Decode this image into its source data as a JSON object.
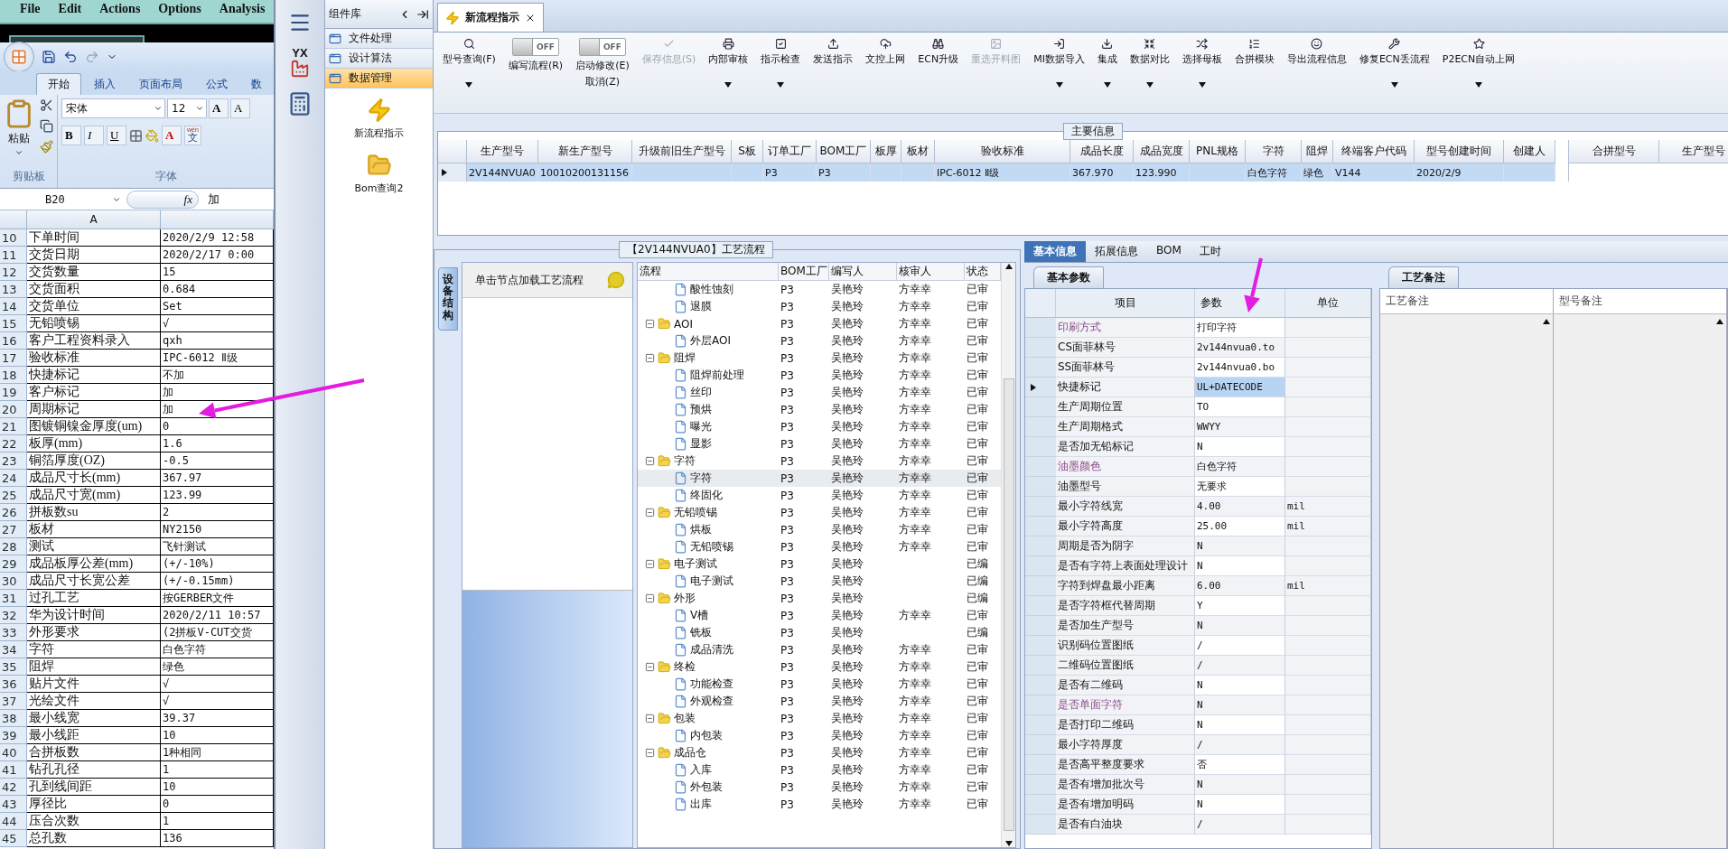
{
  "background_app": {
    "menu": [
      "File",
      "Edit",
      "Actions",
      "Options",
      "Analysis"
    ]
  },
  "excel": {
    "ribbon_tabs": [
      {
        "label": "开始",
        "selected": true
      },
      {
        "label": "插入",
        "selected": false
      },
      {
        "label": "页面布局",
        "selected": false
      },
      {
        "label": "公式",
        "selected": false
      },
      {
        "label": "数",
        "selected": false
      }
    ],
    "clipboard_group": {
      "paste": "粘贴",
      "title": "剪贴板"
    },
    "font_group": {
      "font": "宋体",
      "size": "12",
      "grow": "A",
      "shrink": "A",
      "bold": "B",
      "italic": "I",
      "underline": "U",
      "font_color": "A",
      "phonetic_top": "wén",
      "phonetic": "文",
      "title": "字体"
    },
    "name_box": "B20",
    "fx": "fx",
    "formula": "加",
    "column_header": "A",
    "rows": [
      {
        "num": "10",
        "label": "下单时间",
        "value": "2020/2/9 12:58"
      },
      {
        "num": "11",
        "label": "交货日期",
        "value": "2020/2/17 0:00"
      },
      {
        "num": "12",
        "label": "交货数量",
        "value": "15"
      },
      {
        "num": "13",
        "label": "交货面积",
        "value": "0.684"
      },
      {
        "num": "14",
        "label": "交货单位",
        "value": "Set"
      },
      {
        "num": "15",
        "label": "无铅喷锡",
        "value": "√"
      },
      {
        "num": "16",
        "label": "客户工程资料录入",
        "value": "qxh"
      },
      {
        "num": "17",
        "label": "验收标准",
        "value": "IPC-6012 Ⅱ级"
      },
      {
        "num": "18",
        "label": "快捷标记",
        "value": "不加"
      },
      {
        "num": "19",
        "label": "客户标记",
        "value": "加"
      },
      {
        "num": "20",
        "label": "周期标记",
        "value": "加"
      },
      {
        "num": "21",
        "label": "图镀铜镍金厚度(um)",
        "value": "0"
      },
      {
        "num": "22",
        "label": "板厚(mm)",
        "value": "1.6"
      },
      {
        "num": "23",
        "label": "铜箔厚度(OZ)",
        "value": "-0.5"
      },
      {
        "num": "24",
        "label": "成品尺寸长(mm)",
        "value": "367.97"
      },
      {
        "num": "25",
        "label": "成品尺寸宽(mm)",
        "value": "123.99"
      },
      {
        "num": "26",
        "label": "拼板数su",
        "value": "2"
      },
      {
        "num": "27",
        "label": "板材",
        "value": "NY2150"
      },
      {
        "num": "28",
        "label": "测试",
        "value": "飞针测试"
      },
      {
        "num": "29",
        "label": "成品板厚公差(mm)",
        "value": "(+/-10%)"
      },
      {
        "num": "30",
        "label": "成品尺寸长宽公差",
        "value": "(+/-0.15mm)"
      },
      {
        "num": "31",
        "label": "过孔工艺",
        "value": "按GERBER文件"
      },
      {
        "num": "32",
        "label": "华为设计时间",
        "value": "2020/2/11 10:57"
      },
      {
        "num": "33",
        "label": "外形要求",
        "value": "(2拼板V-CUT交货"
      },
      {
        "num": "34",
        "label": "字符",
        "value": "白色字符"
      },
      {
        "num": "35",
        "label": "阻焊",
        "value": "绿色"
      },
      {
        "num": "36",
        "label": "贴片文件",
        "value": "√"
      },
      {
        "num": "37",
        "label": "光绘文件",
        "value": "√"
      },
      {
        "num": "38",
        "label": "最小线宽",
        "value": "39.37"
      },
      {
        "num": "39",
        "label": "最小线距",
        "value": "10"
      },
      {
        "num": "40",
        "label": "合拼板数",
        "value": "1种相同"
      },
      {
        "num": "41",
        "label": "钻孔孔径",
        "value": "1"
      },
      {
        "num": "42",
        "label": "孔到线间距",
        "value": "10"
      },
      {
        "num": "43",
        "label": "厚径比",
        "value": "0"
      },
      {
        "num": "44",
        "label": "压合次数",
        "value": "1"
      },
      {
        "num": "45",
        "label": "总孔数",
        "value": "136"
      }
    ]
  },
  "nav": {
    "logo": "YX"
  },
  "component_library": {
    "title": "组件库",
    "items": [
      {
        "label": "文件处理",
        "selected": false
      },
      {
        "label": "设计算法",
        "selected": false
      },
      {
        "label": "数据管理",
        "selected": true
      }
    ],
    "tools": [
      {
        "label": "新流程指示",
        "kind": "bolt"
      },
      {
        "label": "Bom查询2",
        "kind": "folder"
      }
    ]
  },
  "doc_tab": {
    "label": "新流程指示"
  },
  "toolbar": [
    {
      "kind": "button",
      "label": [
        "型号查询(F)"
      ],
      "dropdown": true,
      "disabled": false
    },
    {
      "kind": "toggle",
      "label": [
        "编写流程(R)"
      ],
      "on": false,
      "state_text": "OFF"
    },
    {
      "kind": "toggle",
      "label": [
        "启动修改(E)",
        "取消(Z)"
      ],
      "on": false,
      "state_text": "OFF"
    },
    {
      "kind": "button",
      "label": [
        "保存信息(S)"
      ],
      "dropdown": false,
      "disabled": true
    },
    {
      "kind": "button",
      "label": [
        "内部审核"
      ],
      "dropdown": true,
      "disabled": false
    },
    {
      "kind": "button",
      "label": [
        "指示检查"
      ],
      "dropdown": true,
      "disabled": false
    },
    {
      "kind": "button",
      "label": [
        "发送指示"
      ],
      "dropdown": false,
      "disabled": false
    },
    {
      "kind": "button",
      "label": [
        "文控上网"
      ],
      "dropdown": false,
      "disabled": false
    },
    {
      "kind": "button",
      "label": [
        "ECN升级"
      ],
      "dropdown": false,
      "disabled": false
    },
    {
      "kind": "button",
      "label": [
        "重选开料图"
      ],
      "dropdown": false,
      "disabled": true
    },
    {
      "kind": "button",
      "label": [
        "MI数据导入"
      ],
      "dropdown": true,
      "disabled": false
    },
    {
      "kind": "button",
      "label": [
        "集成"
      ],
      "dropdown": true,
      "disabled": false
    },
    {
      "kind": "button",
      "label": [
        "数据对比"
      ],
      "dropdown": true,
      "disabled": false
    },
    {
      "kind": "button",
      "label": [
        "选择母板"
      ],
      "dropdown": true,
      "disabled": false
    },
    {
      "kind": "button",
      "label": [
        "合拼模块"
      ],
      "dropdown": false,
      "disabled": false
    },
    {
      "kind": "button",
      "label": [
        "导出流程信息"
      ],
      "dropdown": false,
      "disabled": false
    },
    {
      "kind": "button",
      "label": [
        "修复ECN丢流程"
      ],
      "dropdown": true,
      "disabled": false
    },
    {
      "kind": "button",
      "label": [
        "P2ECN自动上网"
      ],
      "dropdown": true,
      "disabled": false
    }
  ],
  "main_info": {
    "title": "主要信息",
    "columns": [
      "生产型号",
      "新生产型号",
      "升级前旧生产型号",
      "S板",
      "订单工厂",
      "BOM工厂",
      "板厚",
      "板材",
      "验收标准",
      "成品长度",
      "成品宽度",
      "PNL规格",
      "字符",
      "阻焊",
      "终端客户代码",
      "型号创建时间",
      "创建人"
    ],
    "rows": [
      {
        "selected": true,
        "cells": [
          "2V144NVUA0",
          "10010200131156",
          null,
          null,
          "P3",
          "P3",
          null,
          null,
          "IPC-6012 Ⅱ级",
          "367.970",
          "123.990",
          null,
          "白色字符",
          "绿色",
          "V144",
          "2020/2/9",
          null
        ]
      }
    ],
    "merge_columns": [
      "合拼型号",
      "生产型号"
    ]
  },
  "flow": {
    "title": "【2V144NVUA0】工艺流程",
    "side_tab": "设备结构",
    "hint": "单击节点加载工艺流程",
    "columns": [
      "流程",
      "BOM工厂",
      "编写人",
      "核审人",
      "状态"
    ],
    "partial_group_children": [
      {
        "label": "酸性蚀刻",
        "bom": "P3",
        "writer": "吴艳玲",
        "reviewer": "方幸幸",
        "status": "已审",
        "selected": false
      },
      {
        "label": "退膜",
        "bom": "P3",
        "writer": "吴艳玲",
        "reviewer": "方幸幸",
        "status": "已审",
        "selected": false
      }
    ],
    "groups": [
      {
        "label": "AOI",
        "bom": "P3",
        "writer": "吴艳玲",
        "reviewer": "方幸幸",
        "status": "已审",
        "selected": false,
        "expanded": true,
        "children": [
          {
            "label": "外层AOI",
            "bom": "P3",
            "writer": "吴艳玲",
            "reviewer": "方幸幸",
            "status": "已审",
            "selected": false
          }
        ]
      },
      {
        "label": "阻焊",
        "bom": "P3",
        "writer": "吴艳玲",
        "reviewer": "方幸幸",
        "status": "已审",
        "selected": false,
        "expanded": true,
        "children": [
          {
            "label": "阻焊前处理",
            "bom": "P3",
            "writer": "吴艳玲",
            "reviewer": "方幸幸",
            "status": "已审",
            "selected": false
          },
          {
            "label": "丝印",
            "bom": "P3",
            "writer": "吴艳玲",
            "reviewer": "方幸幸",
            "status": "已审",
            "selected": false
          },
          {
            "label": "预烘",
            "bom": "P3",
            "writer": "吴艳玲",
            "reviewer": "方幸幸",
            "status": "已审",
            "selected": false
          },
          {
            "label": "曝光",
            "bom": "P3",
            "writer": "吴艳玲",
            "reviewer": "方幸幸",
            "status": "已审",
            "selected": false
          },
          {
            "label": "显影",
            "bom": "P3",
            "writer": "吴艳玲",
            "reviewer": "方幸幸",
            "status": "已审",
            "selected": false
          }
        ]
      },
      {
        "label": "字符",
        "bom": "P3",
        "writer": "吴艳玲",
        "reviewer": "方幸幸",
        "status": "已审",
        "selected": false,
        "expanded": true,
        "children": [
          {
            "label": "字符",
            "bom": "P3",
            "writer": "吴艳玲",
            "reviewer": "方幸幸",
            "status": "已审",
            "selected": true
          },
          {
            "label": "终固化",
            "bom": "P3",
            "writer": "吴艳玲",
            "reviewer": "方幸幸",
            "status": "已审",
            "selected": false
          }
        ]
      },
      {
        "label": "无铅喷锡",
        "bom": "P3",
        "writer": "吴艳玲",
        "reviewer": "方幸幸",
        "status": "已审",
        "selected": false,
        "expanded": true,
        "children": [
          {
            "label": "烘板",
            "bom": "P3",
            "writer": "吴艳玲",
            "reviewer": "方幸幸",
            "status": "已审",
            "selected": false
          },
          {
            "label": "无铅喷锡",
            "bom": "P3",
            "writer": "吴艳玲",
            "reviewer": "方幸幸",
            "status": "已审",
            "selected": false
          }
        ]
      },
      {
        "label": "电子测试",
        "bom": "P3",
        "writer": "吴艳玲",
        "status": "已编",
        "selected": false,
        "expanded": true,
        "children": [
          {
            "label": "电子测试",
            "bom": "P3",
            "writer": "吴艳玲",
            "status": "已编",
            "selected": false
          }
        ]
      },
      {
        "label": "外形",
        "bom": "P3",
        "writer": "吴艳玲",
        "status": "已编",
        "selected": false,
        "expanded": true,
        "children": [
          {
            "label": "V槽",
            "bom": "P3",
            "writer": "吴艳玲",
            "reviewer": "方幸幸",
            "status": "已审",
            "selected": false
          },
          {
            "label": "铣板",
            "bom": "P3",
            "writer": "吴艳玲",
            "status": "已编",
            "selected": false
          },
          {
            "label": "成品清洗",
            "bom": "P3",
            "writer": "吴艳玲",
            "reviewer": "方幸幸",
            "status": "已审",
            "selected": false
          }
        ]
      },
      {
        "label": "终检",
        "bom": "P3",
        "writer": "吴艳玲",
        "reviewer": "方幸幸",
        "status": "已审",
        "selected": false,
        "expanded": true,
        "children": [
          {
            "label": "功能检查",
            "bom": "P3",
            "writer": "吴艳玲",
            "reviewer": "方幸幸",
            "status": "已审",
            "selected": false
          },
          {
            "label": "外观检查",
            "bom": "P3",
            "writer": "吴艳玲",
            "reviewer": "方幸幸",
            "status": "已审",
            "selected": false
          }
        ]
      },
      {
        "label": "包装",
        "bom": "P3",
        "writer": "吴艳玲",
        "reviewer": "方幸幸",
        "status": "已审",
        "selected": false,
        "expanded": true,
        "children": [
          {
            "label": "内包装",
            "bom": "P3",
            "writer": "吴艳玲",
            "reviewer": "方幸幸",
            "status": "已审",
            "selected": false
          }
        ]
      },
      {
        "label": "成品仓",
        "bom": "P3",
        "writer": "吴艳玲",
        "reviewer": "方幸幸",
        "status": "已审",
        "selected": false,
        "expanded": true,
        "children": [
          {
            "label": "入库",
            "bom": "P3",
            "writer": "吴艳玲",
            "reviewer": "方幸幸",
            "status": "已审",
            "selected": false
          },
          {
            "label": "外包装",
            "bom": "P3",
            "writer": "吴艳玲",
            "reviewer": "方幸幸",
            "status": "已审",
            "selected": false
          },
          {
            "label": "出库",
            "bom": "P3",
            "writer": "吴艳玲",
            "reviewer": "方幸幸",
            "status": "已审",
            "selected": false
          }
        ]
      }
    ]
  },
  "info_tabs": [
    {
      "label": "基本信息",
      "selected": true
    },
    {
      "label": "拓展信息",
      "selected": false
    },
    {
      "label": "BOM",
      "selected": false
    },
    {
      "label": "工时",
      "selected": false
    }
  ],
  "params": {
    "tab": "基本参数",
    "columns": [
      "项目",
      "参数",
      "单位"
    ],
    "rows": [
      {
        "item": "印刷方式",
        "value": "打印字符",
        "emphasis": true,
        "selected": false
      },
      {
        "item": "CS面菲林号",
        "value": "2v144nvua0.to",
        "emphasis": false,
        "selected": false
      },
      {
        "item": "SS面菲林号",
        "value": "2v144nvua0.bo",
        "emphasis": false,
        "selected": false
      },
      {
        "item": "快捷标记",
        "value": "UL+DATECODE",
        "emphasis": false,
        "selected": true
      },
      {
        "item": "生产周期位置",
        "value": "TO",
        "emphasis": false,
        "selected": false
      },
      {
        "item": "生产周期格式",
        "value": "WWYY",
        "emphasis": false,
        "selected": false
      },
      {
        "item": "是否加无铅标记",
        "value": "N",
        "emphasis": false,
        "selected": false
      },
      {
        "item": "油墨颜色",
        "value": "白色字符",
        "emphasis": true,
        "selected": false
      },
      {
        "item": "油墨型号",
        "value": "无要求",
        "emphasis": false,
        "selected": false
      },
      {
        "item": "最小字符线宽",
        "value": "4.00",
        "unit": "mil",
        "emphasis": false,
        "selected": false
      },
      {
        "item": "最小字符高度",
        "value": "25.00",
        "unit": "mil",
        "emphasis": false,
        "selected": false
      },
      {
        "item": "周期是否为阴字",
        "value": "N",
        "emphasis": false,
        "selected": false
      },
      {
        "item": "是否有字符上表面处理设计",
        "value": "N",
        "emphasis": false,
        "selected": false
      },
      {
        "item": "字符到焊盘最小距离",
        "value": "6.00",
        "unit": "mil",
        "emphasis": false,
        "selected": false
      },
      {
        "item": "是否字符框代替周期",
        "value": "Y",
        "emphasis": false,
        "selected": false
      },
      {
        "item": "是否加生产型号",
        "value": "N",
        "emphasis": false,
        "selected": false
      },
      {
        "item": "识别码位置图纸",
        "value": "/",
        "emphasis": false,
        "selected": false
      },
      {
        "item": "二维码位置图纸",
        "value": "/",
        "emphasis": false,
        "selected": false
      },
      {
        "item": "是否有二维码",
        "value": "N",
        "emphasis": false,
        "selected": false
      },
      {
        "item": "是否单面字符",
        "value": "N",
        "emphasis": true,
        "selected": false
      },
      {
        "item": "是否打印二维码",
        "value": "N",
        "emphasis": false,
        "selected": false
      },
      {
        "item": "最小字符厚度",
        "value": "/",
        "emphasis": false,
        "selected": false
      },
      {
        "item": "是否高平整度要求",
        "value": "否",
        "emphasis": false,
        "selected": false
      },
      {
        "item": "是否有增加批次号",
        "value": "N",
        "emphasis": false,
        "selected": false
      },
      {
        "item": "是否有增加明码",
        "value": "N",
        "emphasis": false,
        "selected": false
      },
      {
        "item": "是否有白油块",
        "value": "/",
        "emphasis": false,
        "selected": false
      }
    ]
  },
  "notes": {
    "tab": "工艺备注",
    "columns": [
      "工艺备注",
      "型号备注"
    ]
  }
}
